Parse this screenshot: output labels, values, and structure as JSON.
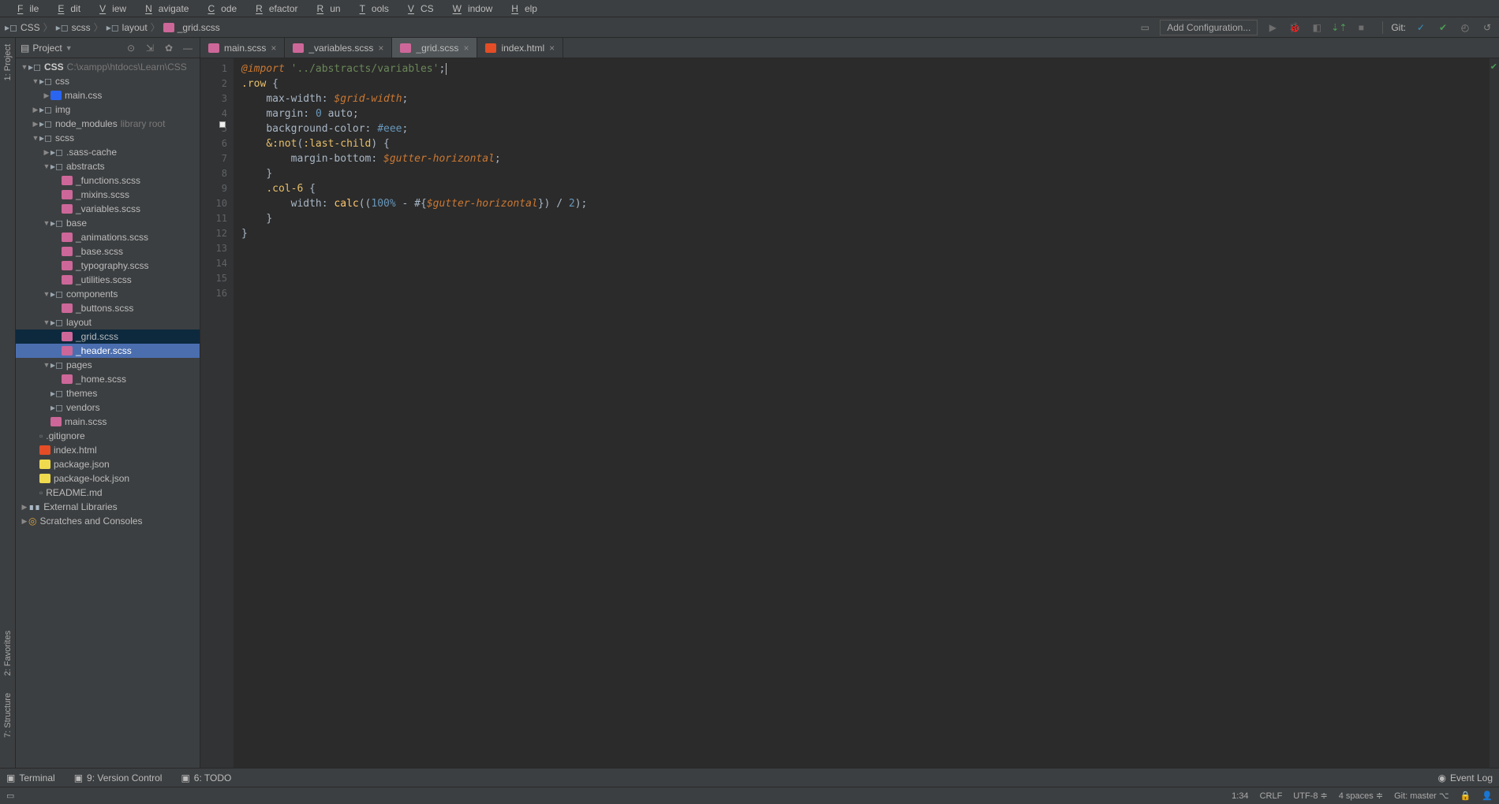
{
  "menu": [
    "File",
    "Edit",
    "View",
    "Navigate",
    "Code",
    "Refactor",
    "Run",
    "Tools",
    "VCS",
    "Window",
    "Help"
  ],
  "breadcrumbs": [
    {
      "icon": "folder",
      "text": "CSS"
    },
    {
      "icon": "folder",
      "text": "scss"
    },
    {
      "icon": "folder",
      "text": "layout"
    },
    {
      "icon": "scss",
      "text": "_grid.scss"
    }
  ],
  "addConfig": "Add Configuration...",
  "gitLabel": "Git:",
  "leftTabs": [
    "1: Project",
    "2: Favorites",
    "7: Structure"
  ],
  "projectPanel": {
    "title": "Project"
  },
  "tree": [
    {
      "d": 0,
      "a": "down",
      "icon": "folder",
      "label": "CSS",
      "suffix": "C:\\xampp\\htdocs\\Learn\\CSS",
      "bold": true
    },
    {
      "d": 1,
      "a": "down",
      "icon": "folder",
      "label": "css"
    },
    {
      "d": 2,
      "a": "right",
      "icon": "css",
      "label": "main.css"
    },
    {
      "d": 1,
      "a": "right",
      "icon": "folder",
      "label": "img"
    },
    {
      "d": 1,
      "a": "right",
      "icon": "folder",
      "label": "node_modules",
      "suffix": "library root"
    },
    {
      "d": 1,
      "a": "down",
      "icon": "folder",
      "label": "scss"
    },
    {
      "d": 2,
      "a": "right",
      "icon": "folder",
      "label": ".sass-cache"
    },
    {
      "d": 2,
      "a": "down",
      "icon": "folder",
      "label": "abstracts"
    },
    {
      "d": 3,
      "a": "",
      "icon": "scss",
      "label": "_functions.scss"
    },
    {
      "d": 3,
      "a": "",
      "icon": "scss",
      "label": "_mixins.scss"
    },
    {
      "d": 3,
      "a": "",
      "icon": "scss",
      "label": "_variables.scss"
    },
    {
      "d": 2,
      "a": "down",
      "icon": "folder",
      "label": "base"
    },
    {
      "d": 3,
      "a": "",
      "icon": "scss",
      "label": "_animations.scss"
    },
    {
      "d": 3,
      "a": "",
      "icon": "scss",
      "label": "_base.scss"
    },
    {
      "d": 3,
      "a": "",
      "icon": "scss",
      "label": "_typography.scss"
    },
    {
      "d": 3,
      "a": "",
      "icon": "scss",
      "label": "_utilities.scss"
    },
    {
      "d": 2,
      "a": "down",
      "icon": "folder",
      "label": "components"
    },
    {
      "d": 3,
      "a": "",
      "icon": "scss",
      "label": "_buttons.scss"
    },
    {
      "d": 2,
      "a": "down",
      "icon": "folder",
      "label": "layout"
    },
    {
      "d": 3,
      "a": "",
      "icon": "scss",
      "label": "_grid.scss",
      "sub": true
    },
    {
      "d": 3,
      "a": "",
      "icon": "scss",
      "label": "_header.scss",
      "sel": true
    },
    {
      "d": 2,
      "a": "down",
      "icon": "folder",
      "label": "pages"
    },
    {
      "d": 3,
      "a": "",
      "icon": "scss",
      "label": "_home.scss"
    },
    {
      "d": 2,
      "a": "",
      "icon": "folder",
      "label": "themes"
    },
    {
      "d": 2,
      "a": "",
      "icon": "folder",
      "label": "vendors"
    },
    {
      "d": 2,
      "a": "",
      "icon": "scss",
      "label": "main.scss"
    },
    {
      "d": 1,
      "a": "",
      "icon": "file",
      "label": ".gitignore"
    },
    {
      "d": 1,
      "a": "",
      "icon": "html",
      "label": "index.html"
    },
    {
      "d": 1,
      "a": "",
      "icon": "js",
      "label": "package.json"
    },
    {
      "d": 1,
      "a": "",
      "icon": "js",
      "label": "package-lock.json"
    },
    {
      "d": 1,
      "a": "",
      "icon": "file",
      "label": "README.md"
    },
    {
      "d": 0,
      "a": "right",
      "icon": "lib",
      "label": "External Libraries"
    },
    {
      "d": 0,
      "a": "right",
      "icon": "scratch",
      "label": "Scratches and Consoles"
    }
  ],
  "tabs": [
    {
      "icon": "scss",
      "label": "main.scss",
      "active": false
    },
    {
      "icon": "scss",
      "label": "_variables.scss",
      "active": false
    },
    {
      "icon": "scss",
      "label": "_grid.scss",
      "active": true
    },
    {
      "icon": "html",
      "label": "index.html",
      "active": false
    }
  ],
  "code": {
    "lines": [
      {
        "n": 1,
        "html": "<span class='kw'>@import</span> <span class='str'>'../abstracts/variables'</span>;<span class='caret'></span>"
      },
      {
        "n": 2,
        "html": ""
      },
      {
        "n": 3,
        "html": "<span class='sel'>.row</span> <span class='brace'>{</span>"
      },
      {
        "n": 4,
        "html": "    <span class='prop'>max-width</span>: <span class='var'>$grid-width</span>;"
      },
      {
        "n": 5,
        "html": "    <span class='prop'>margin</span>: <span class='num'>0</span> <span class='val'>auto</span>;"
      },
      {
        "n": 6,
        "html": "    <span class='prop'>background-color</span>: <span class='num'>#eee</span>;",
        "marker": true
      },
      {
        "n": 7,
        "html": ""
      },
      {
        "n": 8,
        "html": "    <span class='sel'>&amp;</span><span class='pseudo'>:not</span>(<span class='pseudo'>:last-child</span>) <span class='brace'>{</span>"
      },
      {
        "n": 9,
        "html": "        <span class='prop'>margin-bottom</span>: <span class='var'>$gutter-horizontal</span>;"
      },
      {
        "n": 10,
        "html": "    <span class='brace'>}</span>"
      },
      {
        "n": 11,
        "html": ""
      },
      {
        "n": 12,
        "html": "    <span class='sel'>.col-6</span> <span class='brace'>{</span>"
      },
      {
        "n": 13,
        "html": "        <span class='prop'>width</span>: <span class='fn'>calc</span>((<span class='num'>100%</span> <span class='op'>-</span> #{<span class='var'>$gutter-horizontal</span>}) <span class='op'>/</span> <span class='num'>2</span>);"
      },
      {
        "n": 14,
        "html": "    <span class='brace'>}</span>"
      },
      {
        "n": 15,
        "html": "<span class='brace'>}</span>"
      },
      {
        "n": 16,
        "html": ""
      }
    ]
  },
  "bottomTools": [
    {
      "icon": "terminal",
      "label": "Terminal"
    },
    {
      "icon": "vcs",
      "label": "9: Version Control"
    },
    {
      "icon": "todo",
      "label": "6: TODO"
    }
  ],
  "eventLog": "Event Log",
  "status": {
    "pos": "1:34",
    "lineEnd": "CRLF",
    "enc": "UTF-8",
    "indent": "4 spaces",
    "git": "Git: master"
  }
}
